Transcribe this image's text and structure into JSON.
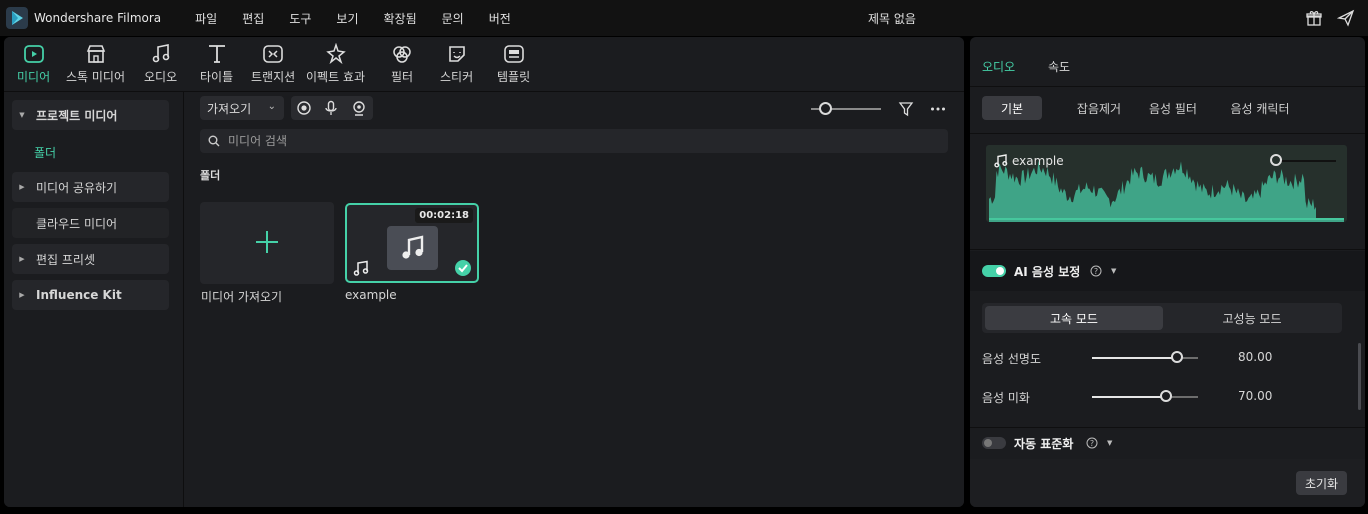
{
  "app": {
    "name": "Wondershare Filmora",
    "document_title": "제목 없음"
  },
  "menu": [
    "파일",
    "편집",
    "도구",
    "보기",
    "확장됨",
    "문의",
    "버전"
  ],
  "toolbar": {
    "tools": [
      {
        "label": "미디어",
        "icon": "media-icon",
        "active": true
      },
      {
        "label": "스톡 미디어",
        "icon": "stock-media-icon",
        "active": false
      },
      {
        "label": "오디오",
        "icon": "audio-icon",
        "active": false
      },
      {
        "label": "타이틀",
        "icon": "title-icon",
        "active": false
      },
      {
        "label": "트랜지션",
        "icon": "transition-icon",
        "active": false
      },
      {
        "label": "이펙트 효과",
        "icon": "effect-icon",
        "active": false
      },
      {
        "label": "필터",
        "icon": "filter-icon",
        "active": false
      },
      {
        "label": "스티커",
        "icon": "sticker-icon",
        "active": false
      },
      {
        "label": "템플릿",
        "icon": "template-icon",
        "active": false
      }
    ]
  },
  "sidebar": {
    "items": [
      {
        "label": "프로젝트 미디어",
        "expanded": true
      },
      {
        "label": "미디어 공유하기",
        "expanded": false
      },
      {
        "label": "클라우드 미디어",
        "expanded": false
      },
      {
        "label": "편집 프리셋",
        "expanded": false
      },
      {
        "label": "Influence Kit",
        "expanded": false
      }
    ],
    "subitem": "폴더"
  },
  "media": {
    "import_label": "가져오기",
    "search_placeholder": "미디어 검색",
    "folder_label": "폴더",
    "import_card_label": "미디어 가져오기",
    "clip": {
      "name": "example",
      "duration": "00:02:18",
      "type": "audio"
    }
  },
  "right_panel": {
    "tabs": [
      {
        "label": "오디오",
        "active": true
      },
      {
        "label": "속도",
        "active": false
      }
    ],
    "subtabs": [
      {
        "label": "기본",
        "active": true
      },
      {
        "label": "잡음제거",
        "active": false
      },
      {
        "label": "음성 필터",
        "active": false
      },
      {
        "label": "음성 캐릭터",
        "active": false
      }
    ],
    "waveform_title": "example",
    "ai_section": {
      "title": "AI 음성 보정",
      "enabled": true
    },
    "modes": [
      {
        "label": "고속 모드",
        "active": true
      },
      {
        "label": "고성능 모드",
        "active": false
      }
    ],
    "params": [
      {
        "label": "음성 선명도",
        "value": "80.00",
        "fraction": 0.8
      },
      {
        "label": "음성 미화",
        "value": "70.00",
        "fraction": 0.7
      }
    ],
    "auto_section": {
      "title": "자동 표준화",
      "enabled": false
    },
    "reset_label": "초기화"
  },
  "colors": {
    "accent": "#45d1a8",
    "panel": "#1b1c1f",
    "background": "#000000"
  }
}
